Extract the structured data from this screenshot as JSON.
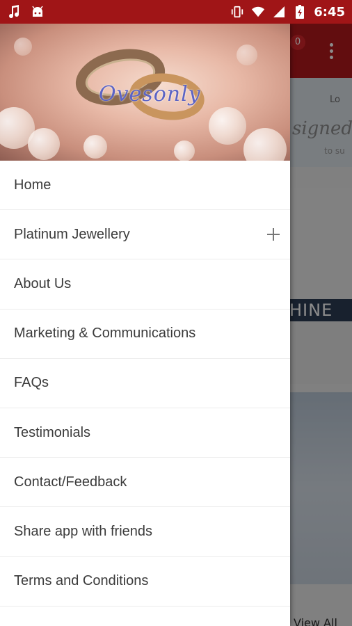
{
  "status_bar": {
    "time": "6:45",
    "icons": [
      "music-note-icon",
      "android-icon",
      "vibrate-icon",
      "wifi-icon",
      "signal-icon",
      "battery-charging-icon"
    ]
  },
  "background_app": {
    "cart_count": "0",
    "banner_text": "signed",
    "banner_subtext": "to su",
    "banner_corner": "Lo",
    "shine_text": "HINE",
    "view_all": "View All"
  },
  "drawer": {
    "header_logo": "Ovesonly",
    "menu_items": [
      {
        "label": "Home",
        "expandable": false
      },
      {
        "label": "Platinum Jewellery",
        "expandable": true
      },
      {
        "label": "About Us",
        "expandable": false
      },
      {
        "label": "Marketing & Communications",
        "expandable": false
      },
      {
        "label": "FAQs",
        "expandable": false
      },
      {
        "label": "Testimonials",
        "expandable": false
      },
      {
        "label": "Contact/Feedback",
        "expandable": false
      },
      {
        "label": "Share app with friends",
        "expandable": false
      },
      {
        "label": "Terms and Conditions",
        "expandable": false
      }
    ]
  },
  "colors": {
    "status_bar": "#a01517",
    "toolbar": "#b3191c",
    "drawer_bg": "#ffffff",
    "menu_text": "#3b3b3b"
  }
}
